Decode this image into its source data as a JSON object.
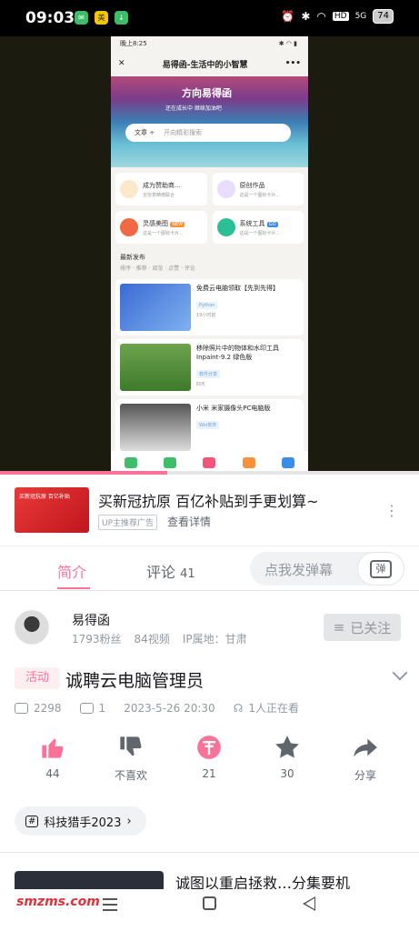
{
  "status_bar": {
    "time": "09:03",
    "battery": "74",
    "hd": "HD",
    "signal": "5G"
  },
  "video": {
    "inner": {
      "time": "晚上8:25",
      "app_title": "易得函-生活中的小智慧",
      "banner_title": "方向易得函",
      "banner_sub": "还在成长中 继续加油吧",
      "search_category": "文章 ÷",
      "search_placeholder": "开向精彩搜索",
      "cards": [
        {
          "title": "成为赞助商…",
          "sub": "全协意精榜联合"
        },
        {
          "title": "原创作品",
          "sub": "这是一个图标卡片…"
        },
        {
          "title": "灵感美图",
          "sub": "这是一个图标卡片…",
          "badge": "NEW"
        },
        {
          "title": "系统工具",
          "sub": "这是一个图标卡片…",
          "badge": "GO"
        }
      ],
      "section": "最新发布",
      "sort": "排序 · 推荐 · 阅览 · 点赞 · 评论",
      "posts": [
        {
          "title": "免费云电脑领取【先到先得】",
          "tag": "Python",
          "author": "19小时前"
        },
        {
          "title": "移除照片中的物体和水印工具 Inpaint-9.2 绿色版",
          "tag": "软件分享",
          "author": "四天"
        },
        {
          "title": "小米 米家摄像头PC电脑版",
          "tag": "Win软件",
          "author": ""
        }
      ]
    },
    "progress": 0.4
  },
  "ad": {
    "image_text": "买新冠抗原 百亿补贴",
    "title": "买新冠抗原 百亿补贴到手更划算~",
    "badge": "UP主推荐广告",
    "link": "查看详情"
  },
  "tabs": {
    "intro": "简介",
    "comments": "评论",
    "comment_count": "41",
    "danmaku_placeholder": "点我发弹幕",
    "danmaku_icon": "弹"
  },
  "author": {
    "name": "易得函",
    "fans": "1793粉丝",
    "videos": "84视频",
    "ip": "IP属地：甘肃",
    "follow": "已关注"
  },
  "video_info": {
    "tag": "活动",
    "title": "诚聘云电脑管理员",
    "plays": "2298",
    "danmaku": "1",
    "date": "2023-5-26 20:30",
    "watching": "1人正在看"
  },
  "actions": {
    "like": "44",
    "dislike": "不喜欢",
    "coin": "21",
    "favorite": "30",
    "share": "分享"
  },
  "topic": "科技猎手2023",
  "recommend_title": "诚图以重启拯救…分集要机",
  "watermark": "smzms.com",
  "colors": {
    "accent": "#fb7299",
    "text": "#18191c",
    "muted": "#9499a0"
  }
}
